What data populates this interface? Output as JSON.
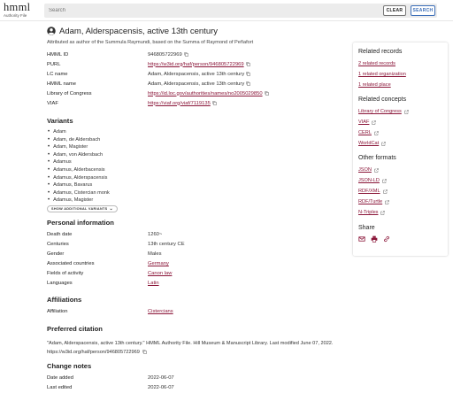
{
  "header": {
    "logo": "hmml",
    "logo_sub": "Authority File",
    "search_placeholder": "Search",
    "clear_label": "CLEAR",
    "search_label": "SEARCH"
  },
  "record": {
    "title": "Adam, Alderspacensis, active 13th century",
    "attribution": "Attributed as author of the Summula Raymundi, based on the Summa of Raymond of Peñafort",
    "identifiers": [
      {
        "label": "HMML ID",
        "value": "946805722969",
        "link": false,
        "copy": true
      },
      {
        "label": "PURL",
        "value": "https://w3id.org/haf/person/946805722969",
        "link": true,
        "copy": true
      },
      {
        "label": "LC name",
        "value": "Adam, Alderspacensis, active 13th century",
        "link": false,
        "copy": true
      },
      {
        "label": "HMML name",
        "value": "Adam, Alderspacensis, active 13th century",
        "link": false,
        "copy": true
      },
      {
        "label": "Library of Congress",
        "value": "https://id.loc.gov/authorities/names/no2005029850",
        "link": true,
        "copy": true
      },
      {
        "label": "VIAF",
        "value": "https://viaf.org/viaf/7119135",
        "link": true,
        "copy": true
      }
    ]
  },
  "variants": {
    "heading": "Variants",
    "items": [
      "Adam",
      "Adam, de Aldersbach",
      "Adam, Magister",
      "Adam, von Aldersbach",
      "Adamus",
      "Adamus, Alderbacensis",
      "Adamus, Alderspacensis",
      "Adamus, Bavarus",
      "Adamus, Cistercian monk",
      "Adamus, Magister"
    ],
    "show_more": "SHOW ADDITIONAL VARIANTS"
  },
  "personal": {
    "heading": "Personal information",
    "rows": [
      {
        "label": "Death date",
        "value": "1260~",
        "link": false
      },
      {
        "label": "Centuries",
        "value": "13th century CE",
        "link": false
      },
      {
        "label": "Gender",
        "value": "Males",
        "link": false
      },
      {
        "label": "Associated countries",
        "value": "Germany",
        "link": true
      },
      {
        "label": "Fields of activity",
        "value": "Canon law",
        "link": true
      },
      {
        "label": "Languages",
        "value": "Latin",
        "link": true
      }
    ]
  },
  "affiliations": {
    "heading": "Affiliations",
    "rows": [
      {
        "label": "Affiliation",
        "value": "Cistercians",
        "link": true
      }
    ]
  },
  "citation": {
    "heading": "Preferred citation",
    "text": "\"Adam, Alderspacensis, active 13th century.\" HMML Authority File. Hill Museum & Manuscript Library. Last modified June 07, 2022. https://w3id.org/haf/person/946805722969"
  },
  "change_notes": {
    "heading": "Change notes",
    "rows": [
      {
        "label": "Date added",
        "value": "2022-06-07"
      },
      {
        "label": "Last edited",
        "value": "2022-06-07"
      }
    ]
  },
  "sidebar": {
    "related_records_heading": "Related records",
    "related_records": [
      "2 related records",
      "1 related organization",
      "1 related place"
    ],
    "related_concepts_heading": "Related concepts",
    "related_concepts": [
      "Library of Congress",
      "VIAF",
      "CERL",
      "WorldCat"
    ],
    "other_formats_heading": "Other formats",
    "other_formats": [
      "JSON",
      "JSON-LD",
      "RDF/XML",
      "RDF/Turtle",
      "N-Triples"
    ],
    "share_heading": "Share",
    "share_icons": [
      "email-icon",
      "print-icon",
      "link-icon"
    ]
  },
  "colors": {
    "link": "#8a1538",
    "accent": "#3d6fb8"
  }
}
